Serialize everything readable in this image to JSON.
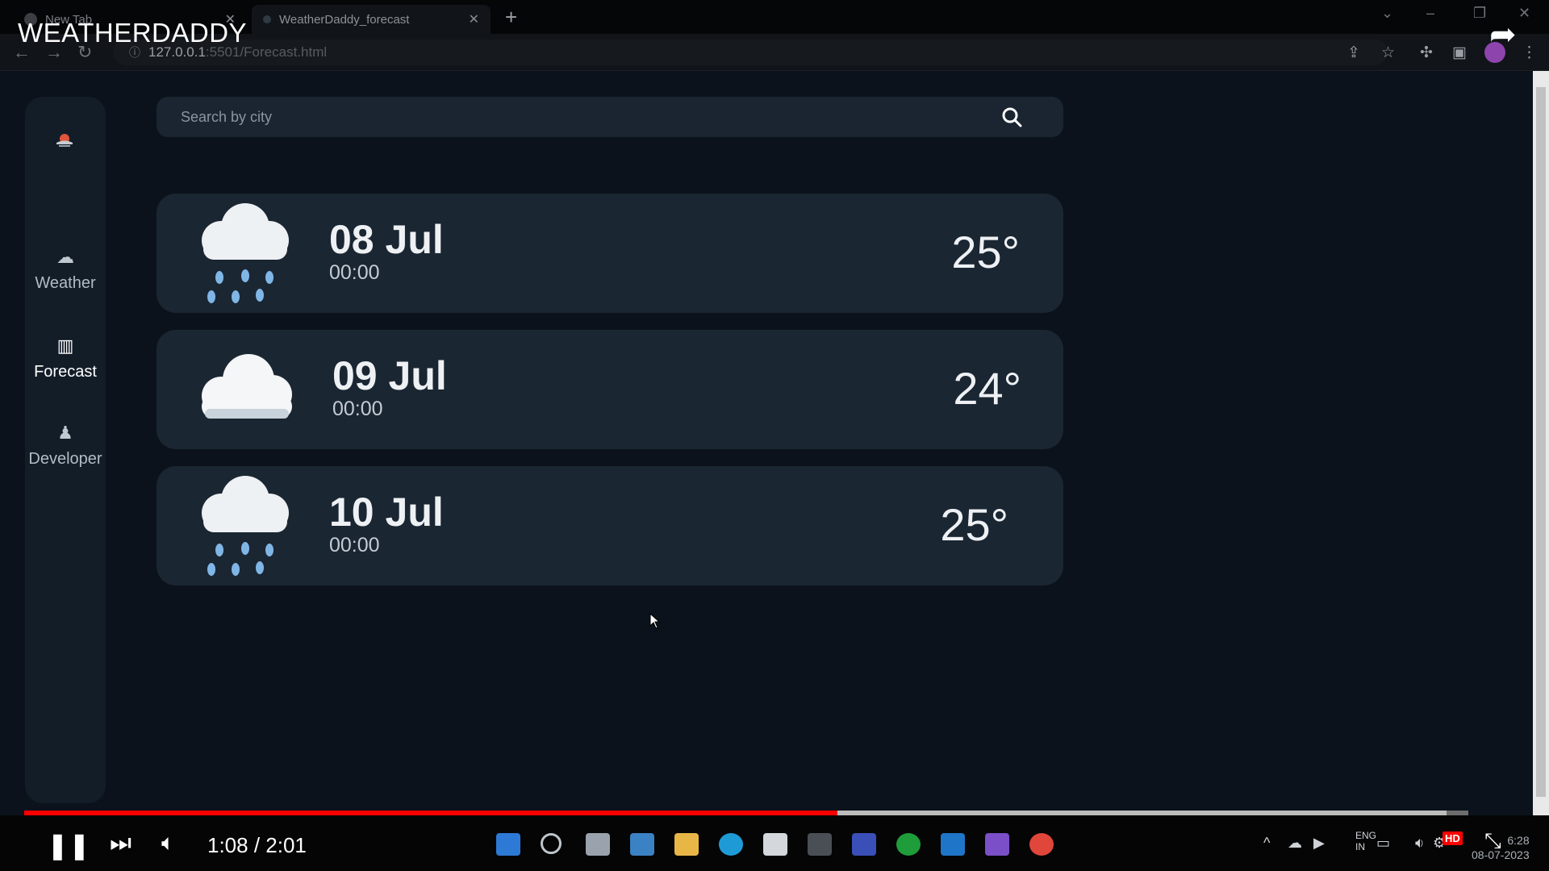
{
  "video": {
    "title": "WEATHERDADDY",
    "time": "1:08 / 2:01",
    "progress": 0.563,
    "buffered": 0.985,
    "quality_badge": "HD"
  },
  "browser": {
    "tabs": [
      {
        "label": "New Tab",
        "active": false
      },
      {
        "label": "WeatherDaddy_forecast",
        "active": true
      }
    ],
    "url_host": "127.0.0.1",
    "url_rest": ":5501/Forecast.html"
  },
  "sidebar": {
    "items": [
      {
        "label": "Weather",
        "icon": "cloud-sun-icon"
      },
      {
        "label": "Forecast",
        "icon": "map-icon"
      },
      {
        "label": "Developer",
        "icon": "user-hand-icon"
      }
    ],
    "active": "Forecast"
  },
  "search": {
    "placeholder": "Search by city",
    "value": ""
  },
  "forecast": [
    {
      "date": "08 Jul",
      "time": "00:00",
      "temp": "25°",
      "icon": "rain-cloud-icon"
    },
    {
      "date": "09 Jul",
      "time": "00:00",
      "temp": "24°",
      "icon": "cloud-icon"
    },
    {
      "date": "10 Jul",
      "time": "00:00",
      "temp": "25°",
      "icon": "rain-cloud-icon"
    }
  ],
  "system": {
    "lang_top": "ENG",
    "lang_bottom": "IN",
    "clock_time": "6:28",
    "clock_date": "08-07-2023"
  },
  "colors": {
    "accent_red": "#ff0000",
    "card_bg": "#1b2633",
    "page_bg": "#0b121b",
    "rain_drop": "#7fb6e6"
  }
}
